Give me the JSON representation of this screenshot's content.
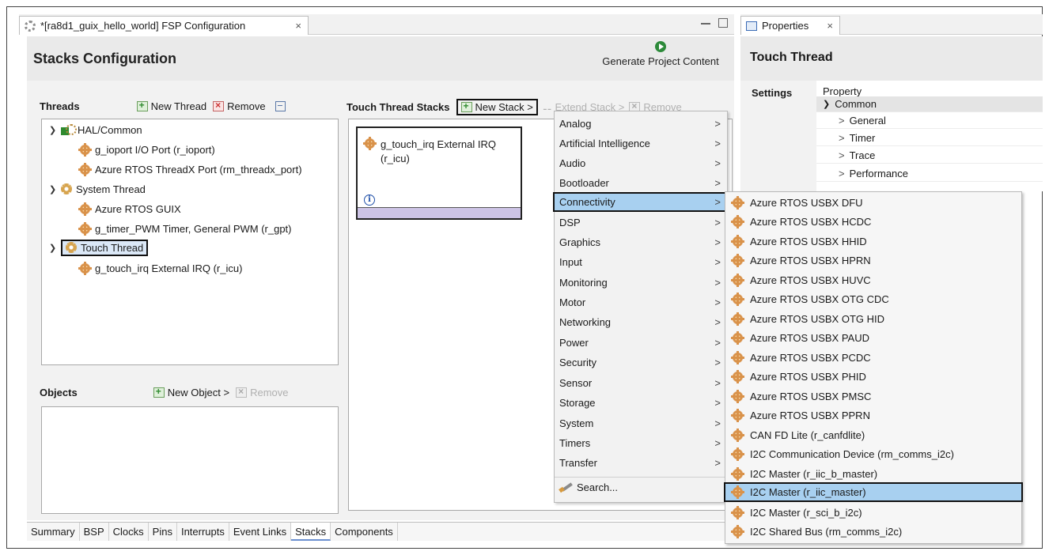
{
  "editor": {
    "tab_title": "*[ra8d1_guix_hello_world] FSP Configuration",
    "close_glyph": "×",
    "page_title": "Stacks Configuration",
    "generate_label": "Generate Project Content"
  },
  "threads": {
    "title": "Threads",
    "new_label": "New Thread",
    "remove_label": "Remove",
    "tree": [
      {
        "label": "HAL/Common",
        "icon": "hal-icon",
        "level": 0
      },
      {
        "label": "g_ioport I/O Port (r_ioport)",
        "icon": "module-icon",
        "level": 1
      },
      {
        "label": "Azure RTOS ThreadX Port (rm_threadx_port)",
        "icon": "module-icon",
        "level": 1
      },
      {
        "label": "System Thread",
        "icon": "gear-icon",
        "level": 0
      },
      {
        "label": "Azure RTOS GUIX",
        "icon": "module-icon",
        "level": 1
      },
      {
        "label": "g_timer_PWM Timer, General PWM (r_gpt)",
        "icon": "module-icon",
        "level": 1
      },
      {
        "label": "Touch Thread",
        "icon": "gear-icon",
        "level": 0,
        "selected": true
      },
      {
        "label": "g_touch_irq External IRQ (r_icu)",
        "icon": "module-icon",
        "level": 1
      }
    ]
  },
  "objects": {
    "title": "Objects",
    "new_label": "New Object >",
    "remove_label": "Remove"
  },
  "stacks": {
    "title": "Touch Thread Stacks",
    "new_label": "New Stack >",
    "extend_label": "Extend Stack >",
    "remove_label": "Remove",
    "card_line1": "g_touch_irq External IRQ",
    "card_line2": "(r_icu)",
    "info_glyph": "i"
  },
  "bottom_tabs": [
    "Summary",
    "BSP",
    "Clocks",
    "Pins",
    "Interrupts",
    "Event Links",
    "Stacks",
    "Components"
  ],
  "active_bottom_tab": "Stacks",
  "properties": {
    "tab_title": "Properties",
    "close_glyph": "×",
    "title": "Touch Thread",
    "settings_label": "Settings",
    "column_header": "Property",
    "rows": [
      {
        "label": "Common",
        "expanded": true
      },
      {
        "label": "General"
      },
      {
        "label": "Timer"
      },
      {
        "label": "Trace"
      },
      {
        "label": "Performance"
      }
    ]
  },
  "menu": {
    "items": [
      "Analog",
      "Artificial Intelligence",
      "Audio",
      "Bootloader",
      "Connectivity",
      "DSP",
      "Graphics",
      "Input",
      "Monitoring",
      "Motor",
      "Networking",
      "Power",
      "Security",
      "Sensor",
      "Storage",
      "System",
      "Timers",
      "Transfer"
    ],
    "selected": "Connectivity",
    "search_label": "Search...",
    "arrow_glyph": ">"
  },
  "submenu": {
    "items": [
      "Azure RTOS USBX DFU",
      "Azure RTOS USBX HCDC",
      "Azure RTOS USBX HHID",
      "Azure RTOS USBX HPRN",
      "Azure RTOS USBX HUVC",
      "Azure RTOS USBX OTG CDC",
      "Azure RTOS USBX OTG HID",
      "Azure RTOS USBX PAUD",
      "Azure RTOS USBX PCDC",
      "Azure RTOS USBX PHID",
      "Azure RTOS USBX PMSC",
      "Azure RTOS USBX PPRN",
      "CAN FD Lite (r_canfdlite)",
      "I2C Communication Device (rm_comms_i2c)",
      "I2C Master (r_iic_b_master)",
      "I2C Master (r_iic_master)",
      "I2C Master (r_sci_b_i2c)",
      "I2C Shared Bus (rm_comms_i2c)"
    ],
    "selected": "I2C Master (r_iic_master)"
  },
  "colors": {
    "selection": "#a8d0f0",
    "highlight_border": "#111111",
    "card_strip": "#cdc4e6"
  }
}
